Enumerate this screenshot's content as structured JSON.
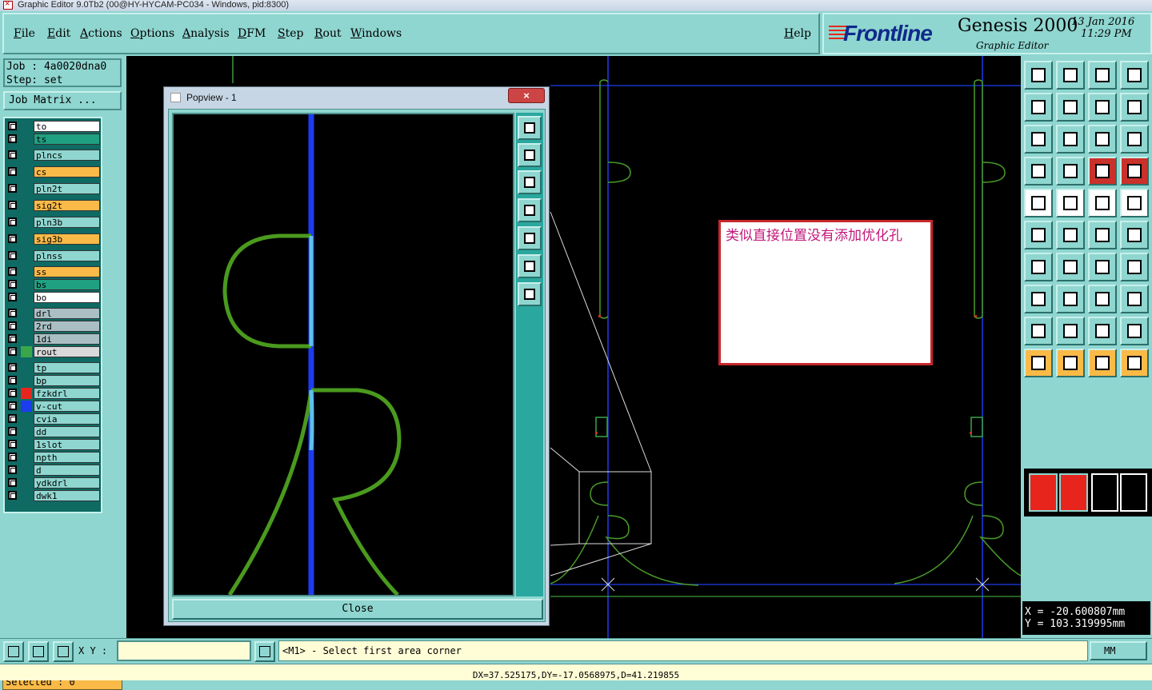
{
  "window": {
    "title": "Graphic Editor 9.0Tb2 (00@HY-HYCAM-PC034 - Windows, pid:8300)"
  },
  "menu": {
    "items": [
      "File",
      "Edit",
      "Actions",
      "Options",
      "Analysis",
      "DFM",
      "Step",
      "Rout",
      "Windows"
    ],
    "help": "Help"
  },
  "brand": {
    "name": "Frontline",
    "product": "Genesis 2000",
    "subtitle": "Graphic Editor",
    "date": "13 Jan 2016",
    "time": "11:29 PM"
  },
  "job": {
    "label": "Job : 4a0020dna0",
    "step": "Step: set",
    "matrix_button": "Job Matrix ..."
  },
  "layers": [
    {
      "name": "to",
      "color": "#ffffff",
      "swatch": ""
    },
    {
      "name": "ts",
      "color": "#1fa081",
      "swatch": ""
    },
    {
      "name": "plncs",
      "color": "#8fd6d0",
      "swatch": ""
    },
    {
      "name": "cs",
      "color": "#f9ba48",
      "swatch": ""
    },
    {
      "name": "pln2t",
      "color": "#8fd6d0",
      "swatch": ""
    },
    {
      "name": "sig2t",
      "color": "#f9ba48",
      "swatch": ""
    },
    {
      "name": "pln3b",
      "color": "#8fd6d0",
      "swatch": ""
    },
    {
      "name": "sig3b",
      "color": "#f9ba48",
      "swatch": ""
    },
    {
      "name": "plnss",
      "color": "#8fd6d0",
      "swatch": ""
    },
    {
      "name": "ss",
      "color": "#f9ba48",
      "swatch": ""
    },
    {
      "name": "bs",
      "color": "#1fa081",
      "swatch": ""
    },
    {
      "name": "bo",
      "color": "#ffffff",
      "swatch": ""
    },
    {
      "name": "drl",
      "color": "#a9bfc4",
      "swatch": ""
    },
    {
      "name": "2rd",
      "color": "#a9bfc4",
      "swatch": ""
    },
    {
      "name": "1di",
      "color": "#a9bfc4",
      "swatch": ""
    },
    {
      "name": "rout",
      "color": "#d9d9d9",
      "swatch": "#3aa64a"
    },
    {
      "name": "tp",
      "color": "#8fd6d0",
      "swatch": ""
    },
    {
      "name": "bp",
      "color": "#8fd6d0",
      "swatch": ""
    },
    {
      "name": "fzkdrl",
      "color": "#8fd6d0",
      "swatch": "#e8251d"
    },
    {
      "name": "v-cut",
      "color": "#8fd6d0",
      "swatch": "#1c3cf0"
    },
    {
      "name": "cvia",
      "color": "#8fd6d0",
      "swatch": ""
    },
    {
      "name": "dd",
      "color": "#8fd6d0",
      "swatch": ""
    },
    {
      "name": "1slot",
      "color": "#8fd6d0",
      "swatch": ""
    },
    {
      "name": "npth",
      "color": "#8fd6d0",
      "swatch": ""
    },
    {
      "name": "d",
      "color": "#8fd6d0",
      "swatch": ""
    },
    {
      "name": "ydkdrl",
      "color": "#8fd6d0",
      "swatch": ""
    },
    {
      "name": "dwk1",
      "color": "#8fd6d0",
      "swatch": ""
    }
  ],
  "selected": "Selected : 0",
  "popup": {
    "title": "Popview - 1",
    "close_button": "Close",
    "close_x": "×"
  },
  "note": {
    "text": "类似直接位置没有添加优化孔"
  },
  "coords": {
    "x": "X = -20.600807mm",
    "y": "Y = 103.319995mm"
  },
  "status": {
    "xy_label": "X Y :",
    "xy_value": "",
    "prompt": "<M1> - Select first area corner",
    "units": "MM",
    "measure": "DX=37.525175,DY=-17.0568975,D=41.219855"
  }
}
